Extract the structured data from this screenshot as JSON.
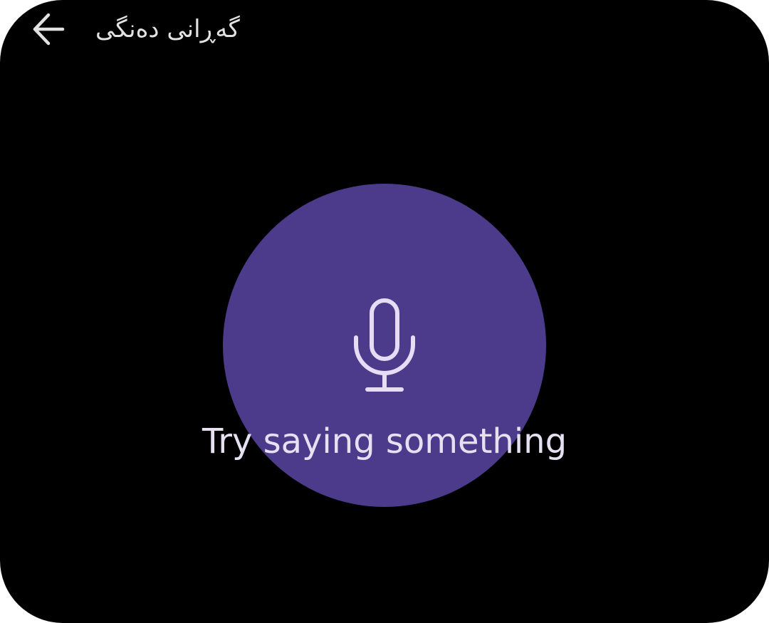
{
  "header": {
    "back_icon": "arrow-left-icon",
    "title": "گەڕانی دەنگی"
  },
  "main": {
    "mic_icon": "microphone-icon",
    "prompt": "Try saying something"
  },
  "colors": {
    "background": "#000000",
    "accent_circle": "#4b3b8a",
    "icon": "#e6dcf5",
    "text": "#e6e0f2"
  }
}
